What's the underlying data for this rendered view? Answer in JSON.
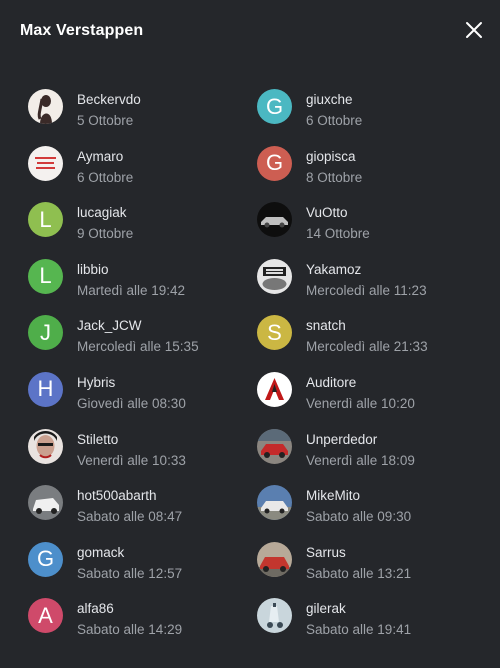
{
  "dialog": {
    "title": "Max Verstappen",
    "close_icon": "close-icon"
  },
  "people": [
    {
      "name": "Beckervdo",
      "when": "5 Ottobre",
      "avatar": {
        "kind": "photo",
        "icon": "woman-photo",
        "bg": "#f2ede8",
        "fg": "#3a2a28"
      }
    },
    {
      "name": "giuxche",
      "when": "6 Ottobre",
      "avatar": {
        "kind": "letter",
        "letter": "G",
        "bg": "#4bb8c2"
      }
    },
    {
      "name": "Aymaro",
      "when": "6 Ottobre",
      "avatar": {
        "kind": "photo",
        "icon": "text-photo",
        "bg": "#f4f1ef",
        "fg": "#d23a3a"
      }
    },
    {
      "name": "giopisca",
      "when": "8 Ottobre",
      "avatar": {
        "kind": "letter",
        "letter": "G",
        "bg": "#cd5e52"
      }
    },
    {
      "name": "lucagiak",
      "when": "9 Ottobre",
      "avatar": {
        "kind": "letter",
        "letter": "L",
        "bg": "#8fbf50"
      }
    },
    {
      "name": "VuOtto",
      "when": "14 Ottobre",
      "avatar": {
        "kind": "photo",
        "icon": "car-dark-photo",
        "bg": "#0e0e0e",
        "fg": "#bfbfbf"
      }
    },
    {
      "name": "libbio",
      "when": "Martedì alle 19:42",
      "avatar": {
        "kind": "letter",
        "letter": "L",
        "bg": "#56b650"
      }
    },
    {
      "name": "Yakamoz",
      "when": "Mercoledì alle 11:23",
      "avatar": {
        "kind": "photo",
        "icon": "car-star-photo",
        "bg": "#e6e6e6",
        "fg": "#222222"
      }
    },
    {
      "name": "Jack_JCW",
      "when": "Mercoledì alle 15:35",
      "avatar": {
        "kind": "letter",
        "letter": "J",
        "bg": "#4fae4a"
      }
    },
    {
      "name": "snatch",
      "when": "Mercoledì alle 21:33",
      "avatar": {
        "kind": "letter",
        "letter": "S",
        "bg": "#cbb743"
      }
    },
    {
      "name": "Hybris",
      "when": "Giovedì alle 08:30",
      "avatar": {
        "kind": "letter",
        "letter": "H",
        "bg": "#5c74c7"
      }
    },
    {
      "name": "Auditore",
      "when": "Venerdì alle 10:20",
      "avatar": {
        "kind": "photo",
        "icon": "assassin-logo",
        "bg": "#ffffff",
        "fg": "#c01818"
      }
    },
    {
      "name": "Stiletto",
      "when": "Venerdì alle 10:33",
      "avatar": {
        "kind": "photo",
        "icon": "face-photo",
        "bg": "#e9e3e0",
        "fg": "#1a1a1a"
      }
    },
    {
      "name": "Unperdedor",
      "when": "Venerdì alle 18:09",
      "avatar": {
        "kind": "photo",
        "icon": "red-car-photo",
        "bg": "#8b8680",
        "fg": "#c42a2a"
      }
    },
    {
      "name": "hot500abarth",
      "when": "Sabato alle 08:47",
      "avatar": {
        "kind": "photo",
        "icon": "white-car-photo",
        "bg": "#7a7d80",
        "fg": "#f0f0f0"
      }
    },
    {
      "name": "MikeMito",
      "when": "Sabato alle 09:30",
      "avatar": {
        "kind": "photo",
        "icon": "blue-car-photo",
        "bg": "#5a7fb0",
        "fg": "#e8e8e8"
      }
    },
    {
      "name": "gomack",
      "when": "Sabato alle 12:57",
      "avatar": {
        "kind": "letter",
        "letter": "G",
        "bg": "#4d8fcb"
      }
    },
    {
      "name": "Sarrus",
      "when": "Sabato alle 13:21",
      "avatar": {
        "kind": "photo",
        "icon": "red-car-street-photo",
        "bg": "#b7a998",
        "fg": "#c3362e"
      }
    },
    {
      "name": "alfa86",
      "when": "Sabato alle 14:29",
      "avatar": {
        "kind": "letter",
        "letter": "A",
        "bg": "#cf4a6a"
      }
    },
    {
      "name": "gilerak",
      "when": "Sabato alle 19:41",
      "avatar": {
        "kind": "photo",
        "icon": "scooter-photo",
        "bg": "#c9d6dc",
        "fg": "#3b4a55"
      }
    }
  ]
}
